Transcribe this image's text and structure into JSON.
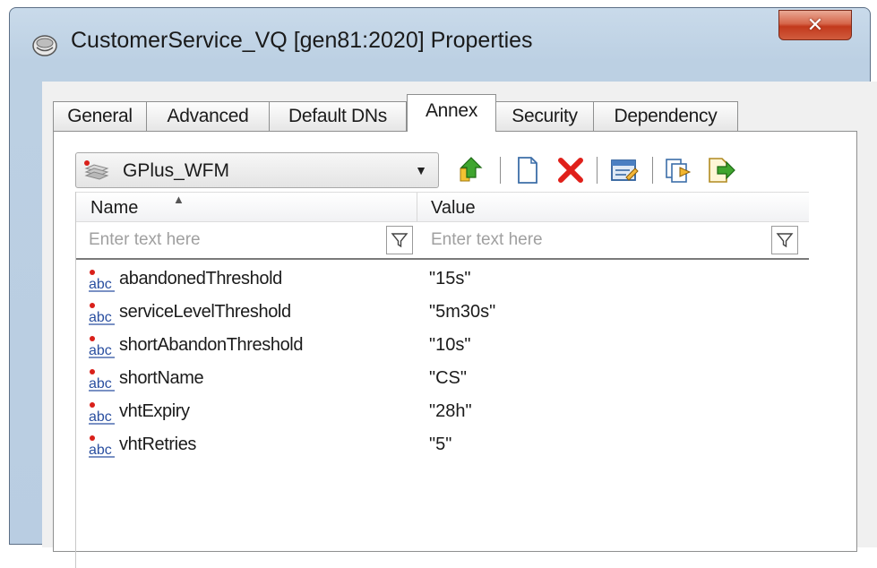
{
  "window": {
    "title": "CustomerService_VQ [gen81:2020] Properties",
    "close_label": "✕"
  },
  "tabs": [
    {
      "label": "General",
      "active": false
    },
    {
      "label": "Advanced",
      "active": false
    },
    {
      "label": "Default DNs",
      "active": false
    },
    {
      "label": "Annex",
      "active": true
    },
    {
      "label": "Security",
      "active": false
    },
    {
      "label": "Dependency",
      "active": false
    }
  ],
  "section_select": {
    "selected": "GPlus_WFM",
    "icon": "section-folder-icon"
  },
  "toolbar": {
    "buttons": [
      "up-level-icon",
      "new-icon",
      "delete-icon",
      "edit-icon",
      "copy-icon",
      "export-icon"
    ]
  },
  "grid": {
    "columns": {
      "name": "Name",
      "value": "Value"
    },
    "sort": {
      "column": "name",
      "direction": "ascending"
    },
    "filter_placeholder": "Enter text here",
    "rows": [
      {
        "name": "abandonedThreshold",
        "value": "\"15s\""
      },
      {
        "name": "serviceLevelThreshold",
        "value": "\"5m30s\""
      },
      {
        "name": "shortAbandonThreshold",
        "value": "\"10s\""
      },
      {
        "name": "shortName",
        "value": "\"CS\""
      },
      {
        "name": "vhtExpiry",
        "value": "\"28h\""
      },
      {
        "name": "vhtRetries",
        "value": "\"5\""
      }
    ],
    "row_icon": "string-type-icon"
  },
  "colors": {
    "window_frame": "#b9cde2",
    "close_button": "#c2391c",
    "delete_icon": "#e0201a"
  }
}
